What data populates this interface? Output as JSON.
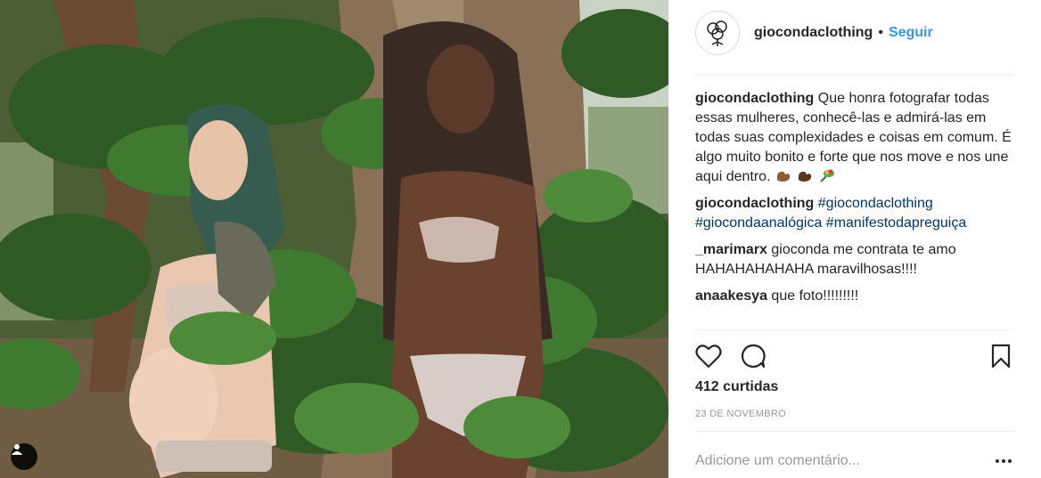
{
  "post": {
    "username": "giocondaclothing",
    "separator": "•",
    "follow_label": "Seguir"
  },
  "comments": [
    {
      "user": "giocondaclothing",
      "text": "Que honra fotografar todas essas mulheres, conhecê-las e admirá-las em todas suas complexidades e coisas em comum. É algo muito bonito e forte que nos move e nos une aqui dentro.",
      "emoji_icons": [
        "flexed-biceps-medium-dark-emoji",
        "flexed-biceps-dark-emoji",
        "bouquet-emoji"
      ]
    },
    {
      "user": "giocondaclothing",
      "hashtags": [
        "#giocondaclothing",
        "#giocondaanalógica",
        "#manifestodapreguiça"
      ]
    },
    {
      "user": "_marimarx",
      "text": "gioconda me contrata te amo HAHAHAHAHAHA maravilhosas!!!!"
    },
    {
      "user": "anaakesya",
      "text": "que foto!!!!!!!!!"
    }
  ],
  "actions": {
    "icons": [
      "heart-icon",
      "comment-icon",
      "bookmark-icon"
    ]
  },
  "likes_label": "412 curtidas",
  "date_label": "23 DE NOVEMBRO",
  "add_comment": {
    "placeholder": "Adicione um comentário..."
  },
  "colors": {
    "link_blue": "#3897f0",
    "hashtag": "#003569",
    "text": "#262626",
    "muted": "#999999"
  }
}
